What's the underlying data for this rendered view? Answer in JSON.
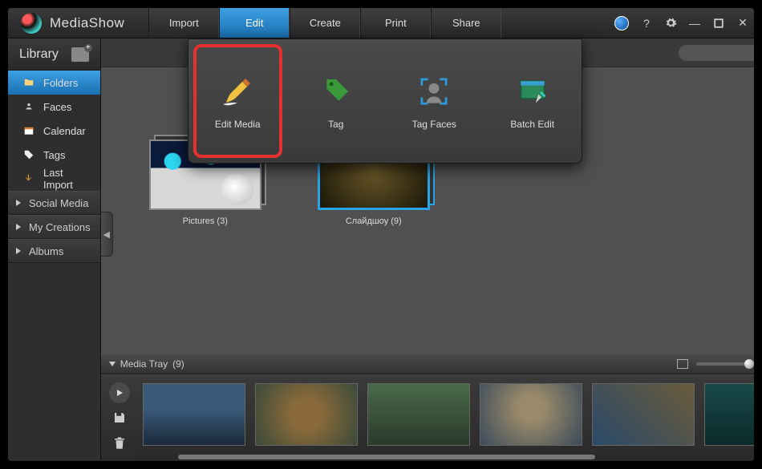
{
  "app": {
    "title": "MediaShow"
  },
  "tabs": {
    "import": "Import",
    "edit": "Edit",
    "create": "Create",
    "print": "Print",
    "share": "Share"
  },
  "sidebar": {
    "header": "Library",
    "items": [
      "Folders",
      "Faces",
      "Calendar",
      "Tags",
      "Last Import"
    ],
    "sections": [
      "Social Media",
      "My Creations",
      "Albums"
    ]
  },
  "editPanel": {
    "editMedia": "Edit Media",
    "tag": "Tag",
    "tagFaces": "Tag Faces",
    "batchEdit": "Batch Edit"
  },
  "gallery": {
    "folder1": "Pictures (3)",
    "folder2": "Слайдшоу (9)"
  },
  "tray": {
    "label": "Media Tray",
    "count": "(9)"
  },
  "search": {
    "placeholder": ""
  }
}
